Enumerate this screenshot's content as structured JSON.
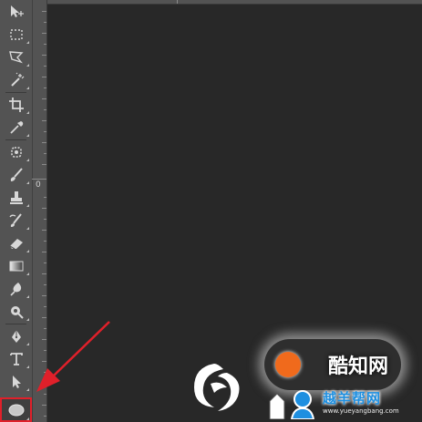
{
  "ruler": {
    "vertical_label": "0"
  },
  "tools": [
    {
      "name": "move-tool",
      "icon": "move-icon"
    },
    {
      "name": "marquee-tool",
      "icon": "rectangle-marquee-icon"
    },
    {
      "name": "lasso-tool",
      "icon": "polygonal-lasso-icon"
    },
    {
      "name": "magic-wand-tool",
      "icon": "magic-wand-icon"
    },
    {
      "name": "crop-tool",
      "icon": "crop-icon"
    },
    {
      "name": "eyedropper-tool",
      "icon": "eyedropper-icon"
    },
    {
      "name": "spot-healing-tool",
      "icon": "healing-brush-icon"
    },
    {
      "name": "brush-tool",
      "icon": "brush-icon"
    },
    {
      "name": "clone-stamp-tool",
      "icon": "stamp-icon"
    },
    {
      "name": "history-brush-tool",
      "icon": "history-brush-icon"
    },
    {
      "name": "eraser-tool",
      "icon": "eraser-icon"
    },
    {
      "name": "gradient-tool",
      "icon": "gradient-icon"
    },
    {
      "name": "blur-tool",
      "icon": "blur-drop-icon"
    },
    {
      "name": "dodge-tool",
      "icon": "dodge-icon"
    },
    {
      "name": "pen-tool",
      "icon": "pen-icon"
    },
    {
      "name": "type-tool",
      "icon": "type-icon"
    },
    {
      "name": "path-selection-tool",
      "icon": "arrow-select-icon"
    },
    {
      "name": "ellipse-tool",
      "icon": "ellipse-icon",
      "selected": true
    }
  ],
  "watermarks": {
    "top_brand": "酷知网",
    "bottom_brand": "越羊帮网",
    "bottom_url": "www.yueyangbang.com"
  },
  "colors": {
    "toolbar_bg": "#535353",
    "canvas_bg": "#282828",
    "highlight": "#e0202a"
  }
}
